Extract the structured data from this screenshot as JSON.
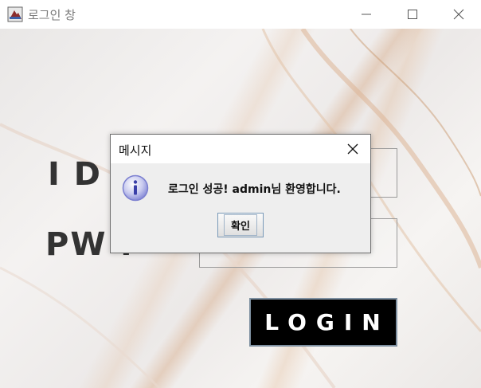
{
  "window": {
    "title": "로그인 창",
    "icons": {
      "app": "app-icon",
      "minimize": "minimize-icon",
      "maximize": "maximize-icon",
      "close": "close-icon"
    }
  },
  "form": {
    "id_label": "I D",
    "pw_label": "PW :",
    "id_value": "",
    "pw_value": "",
    "login_label": "LOGIN"
  },
  "dialog": {
    "title": "메시지",
    "message": "로그인 성공! admin님 환영합니다.",
    "ok_label": "확인",
    "icon": "info-icon"
  },
  "colors": {
    "login_bg": "#000000",
    "login_text": "#ffffff",
    "dialog_body": "#eeeeee",
    "info_icon": "#7b7fd0"
  }
}
